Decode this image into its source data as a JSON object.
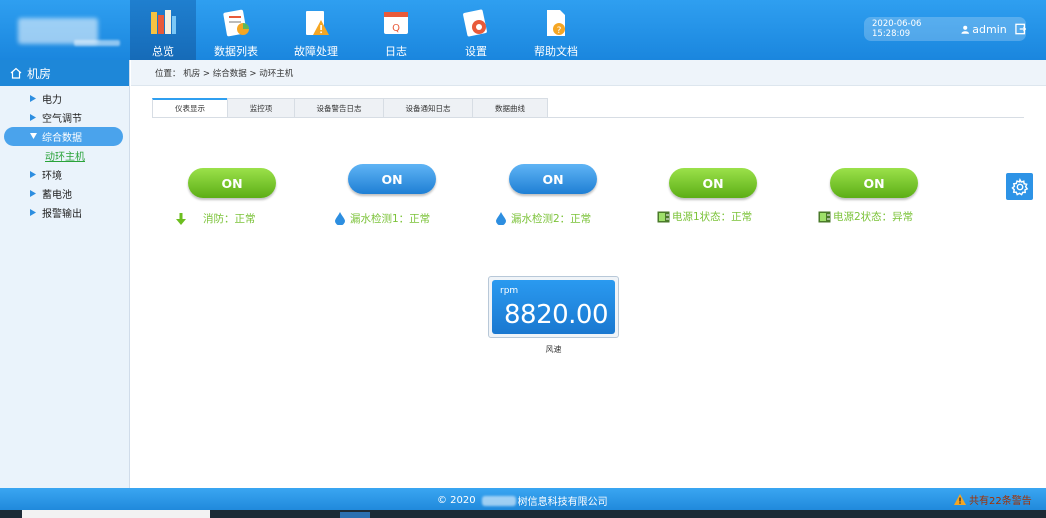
{
  "nav": [
    {
      "label": "总览",
      "icon": "books-icon"
    },
    {
      "label": "数据列表",
      "icon": "data-list-icon"
    },
    {
      "label": "故障处理",
      "icon": "fault-icon"
    },
    {
      "label": "日志",
      "icon": "log-icon"
    },
    {
      "label": "设置",
      "icon": "settings-icon"
    },
    {
      "label": "帮助文档",
      "icon": "help-doc-icon"
    }
  ],
  "user": {
    "datetime": "2020-06-06 15:28:09",
    "name": "admin"
  },
  "sidebar": {
    "title": "机房",
    "items": [
      {
        "label": "电力"
      },
      {
        "label": "空气调节"
      },
      {
        "label": "综合数据"
      },
      {
        "label": "环境"
      },
      {
        "label": "蓄电池"
      },
      {
        "label": "报警输出"
      }
    ],
    "sub_item": "动环主机"
  },
  "breadcrumb": "位置： 机房 > 综合数据 > 动环主机",
  "tabs": [
    {
      "label": "仪表显示"
    },
    {
      "label": "监控项"
    },
    {
      "label": "设备警告日志"
    },
    {
      "label": "设备通知日志"
    },
    {
      "label": "数据曲线"
    }
  ],
  "monitors": [
    {
      "toggle": "ON",
      "color": "#6cbe1f",
      "status": "消防：正常",
      "icon": "arrow-down-icon"
    },
    {
      "toggle": "ON",
      "color": "#2d8ee0",
      "status": "漏水检测1：正常",
      "icon": "water-drop-icon"
    },
    {
      "toggle": "ON",
      "color": "#2d8ee0",
      "status": "漏水检测2：正常",
      "icon": "water-drop-icon"
    },
    {
      "toggle": "ON",
      "color": "#6cbe1f",
      "status": "电源1状态：正常",
      "icon": "power-icon"
    },
    {
      "toggle": "ON",
      "color": "#6cbe1f",
      "status": "电源2状态：异常",
      "icon": "power-icon"
    }
  ],
  "gauge": {
    "unit": "rpm",
    "value": "8820.00",
    "label": "风速"
  },
  "footer": {
    "copyright_prefix": "© 2020",
    "copyright_suffix": "树信息科技有限公司",
    "alert": "共有22条警告"
  }
}
